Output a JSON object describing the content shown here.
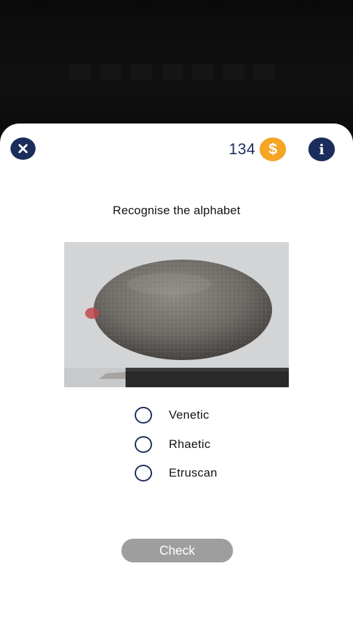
{
  "header": {
    "coin_count": "134",
    "coin_symbol": "$",
    "info_symbol": "i"
  },
  "question": {
    "prompt": "Recognise the alphabet"
  },
  "options": [
    {
      "label": "Venetic",
      "selected": false
    },
    {
      "label": "Rhaetic",
      "selected": false
    },
    {
      "label": "Etruscan",
      "selected": false
    }
  ],
  "actions": {
    "check_label": "Check"
  },
  "colors": {
    "navy": "#1b2d5a",
    "coin": "#f5a524",
    "button_disabled": "#9e9e9e"
  }
}
